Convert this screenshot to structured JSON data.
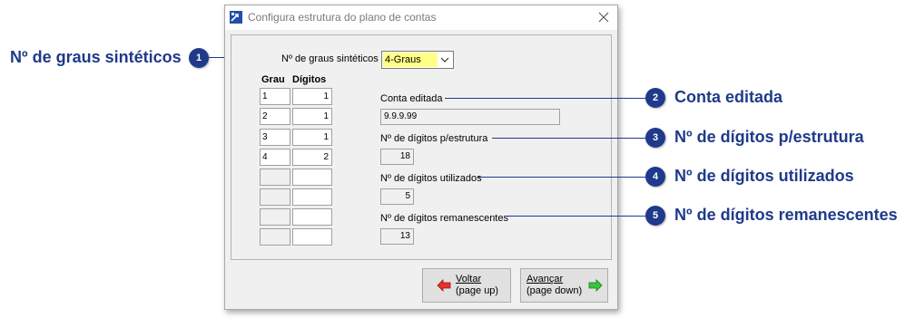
{
  "window": {
    "title": "Configura estrutura do plano de contas"
  },
  "form": {
    "graus_label": "Nº de graus sintéticos",
    "graus_value": "4-Graus",
    "grid": {
      "headers": [
        "Grau",
        "Dígitos"
      ],
      "rows": [
        {
          "grau": "1",
          "digitos": "1"
        },
        {
          "grau": "2",
          "digitos": "1"
        },
        {
          "grau": "3",
          "digitos": "1"
        },
        {
          "grau": "4",
          "digitos": "2"
        },
        {
          "grau": "",
          "digitos": ""
        },
        {
          "grau": "",
          "digitos": ""
        },
        {
          "grau": "",
          "digitos": ""
        },
        {
          "grau": "",
          "digitos": ""
        }
      ]
    },
    "conta_editada_label": "Conta editada",
    "conta_editada_value": "9.9.9.99",
    "digitos_estrutura_label": "Nº de dígitos p/estrutura",
    "digitos_estrutura_value": "18",
    "digitos_utilizados_label": "Nº de dígitos utilizados",
    "digitos_utilizados_value": "5",
    "digitos_remanescentes_label": "Nº de dígitos remanescentes",
    "digitos_remanescentes_value": "13"
  },
  "buttons": {
    "voltar_line1": "Voltar",
    "voltar_line2": "(page up)",
    "avancar_line1": "Avançar",
    "avancar_line2": "(page down)"
  },
  "callouts": [
    {
      "number": "1",
      "text": "Nº de graus sintéticos"
    },
    {
      "number": "2",
      "text": "Conta editada"
    },
    {
      "number": "3",
      "text": "Nº de dígitos p/estrutura"
    },
    {
      "number": "4",
      "text": "Nº de dígitos utilizados"
    },
    {
      "number": "5",
      "text": "Nº de dígitos remanescentes"
    }
  ],
  "colors": {
    "callout": "#1f3a8a",
    "combo_highlight": "#ffff88",
    "window_bg": "#f0f0f0"
  },
  "icons": {
    "app": "window-config-icon",
    "close": "close-icon",
    "voltar": "arrow-left-icon",
    "avancar": "arrow-right-icon",
    "combo": "chevron-down-icon"
  }
}
